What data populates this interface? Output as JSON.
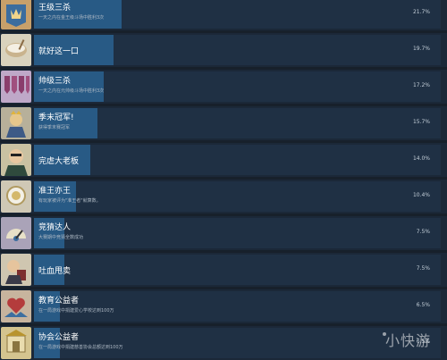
{
  "achievements": [
    {
      "title": "王级三杀",
      "desc": "一天之内在金王级斗场中胜利3次",
      "percent": "21.7%",
      "percent_value": 21.7,
      "icon": "crown-scroll-icon"
    },
    {
      "title": "就好这一口",
      "desc": "",
      "percent": "19.7%",
      "percent_value": 19.7,
      "icon": "bowl-icon"
    },
    {
      "title": "帅级三杀",
      "desc": "一天之内在元帅级斗场中胜利3次",
      "percent": "17.2%",
      "percent_value": 17.2,
      "icon": "banner-icon"
    },
    {
      "title": "季末冠军!",
      "desc": "获得季末赛冠军",
      "percent": "15.7%",
      "percent_value": 15.7,
      "icon": "champion-icon"
    },
    {
      "title": "完虐大老板",
      "desc": "",
      "percent": "14.0%",
      "percent_value": 14.0,
      "icon": "boss-icon"
    },
    {
      "title": "准王亦王",
      "desc": "有玩家被评为\"准王者\"就算数。",
      "percent": "10.4%",
      "percent_value": 10.4,
      "icon": "medal-icon"
    },
    {
      "title": "竞猜达人",
      "desc": "大赛期中竞猜全数成功",
      "percent": "7.5%",
      "percent_value": 7.5,
      "icon": "guess-icon"
    },
    {
      "title": "吐血甩卖",
      "desc": "",
      "percent": "7.5%",
      "percent_value": 7.5,
      "icon": "sale-icon"
    },
    {
      "title": "教育公益者",
      "desc": "在一局游戏中捐建爱心学校达到100万",
      "percent": "6.5%",
      "percent_value": 6.5,
      "icon": "heart-hands-icon"
    },
    {
      "title": "协会公益者",
      "desc": "在一局游戏中捐建慈善协会总额达到100万",
      "percent": "6.5%",
      "percent_value": 6.5,
      "icon": "association-icon"
    }
  ],
  "watermark": "小快游",
  "colors": {
    "progress": "#285a85",
    "panel": "#1f3044",
    "row": "#1b2838"
  }
}
